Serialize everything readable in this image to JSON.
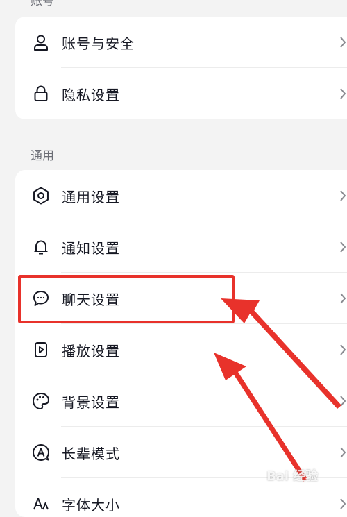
{
  "sections": {
    "account": {
      "label": "账号",
      "items": [
        {
          "label": "账号与安全",
          "icon": "user-icon"
        },
        {
          "label": "隐私设置",
          "icon": "lock-icon"
        }
      ]
    },
    "general": {
      "label": "通用",
      "items": [
        {
          "label": "通用设置",
          "icon": "gear-icon"
        },
        {
          "label": "通知设置",
          "icon": "bell-icon"
        },
        {
          "label": "聊天设置",
          "icon": "chat-bubble-icon"
        },
        {
          "label": "播放设置",
          "icon": "play-icon"
        },
        {
          "label": "背景设置",
          "icon": "palette-icon"
        },
        {
          "label": "长辈模式",
          "icon": "elder-mode-icon"
        },
        {
          "label": "字体大小",
          "icon": "font-size-icon"
        }
      ]
    }
  },
  "annotation": {
    "highlight_color": "#e8322b"
  },
  "watermark": {
    "text": "Bai 经验"
  }
}
